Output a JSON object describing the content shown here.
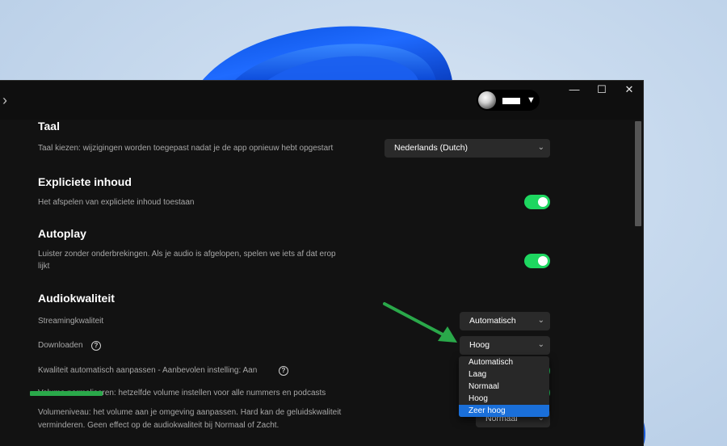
{
  "window": {
    "minimize_icon": "minimize-icon",
    "maximize_icon": "maximize-icon",
    "close_icon": "close-icon",
    "minimize_glyph": "—",
    "maximize_glyph": "☐",
    "close_glyph": "✕",
    "back_glyph": "›"
  },
  "user": {
    "caret": "▼"
  },
  "sections": {
    "language": {
      "title": "Taal",
      "description": "Taal kiezen: wijzigingen worden toegepast nadat je de app opnieuw hebt opgestart",
      "value": "Nederlands (Dutch)"
    },
    "explicit": {
      "title": "Expliciete inhoud",
      "description": "Het afspelen van expliciete inhoud toestaan"
    },
    "autoplay": {
      "title": "Autoplay",
      "description_line1": "Luister zonder onderbrekingen. Als je audio is afgelopen, spelen we iets af dat erop",
      "description_line2": "lijkt"
    },
    "audio_quality": {
      "title": "Audiokwaliteit",
      "streaming_label": "Streamingkwaliteit",
      "streaming_value": "Automatisch",
      "download_label": "Downloaden",
      "download_value": "Hoog",
      "auto_adjust_label": "Kwaliteit automatisch aanpassen - Aanbevolen instelling: Aan",
      "normalize_label": "Volume normaliseren: hetzelfde volume instellen voor alle nummers en podcasts",
      "volume_level_line1": "Volumeniveau: het volume aan je omgeving aanpassen. Hard kan de geluidskwaliteit",
      "volume_level_line2": "verminderen. Geen effect op de audiokwaliteit bij Normaal of Zacht.",
      "volume_level_value": "Normaal"
    }
  },
  "dropdown": {
    "options": [
      "Automatisch",
      "Laag",
      "Normaal",
      "Hoog",
      "Zeer hoog"
    ],
    "selected": "Zeer hoog"
  },
  "icons": {
    "chevron": "⌄",
    "help": "?"
  },
  "colors": {
    "accent_green": "#1ed760",
    "highlight_blue": "#1a6fd9",
    "annotation_green": "#2aa84a"
  }
}
